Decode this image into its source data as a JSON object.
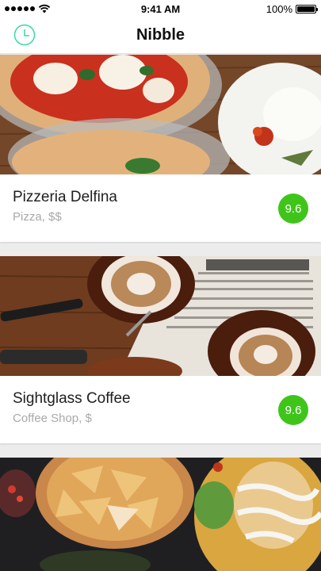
{
  "status_bar": {
    "time": "9:41 AM",
    "battery": "100%",
    "battery_level": 1.0,
    "signal_icon": "signal-dots-icon",
    "wifi_icon": "wifi-icon"
  },
  "nav": {
    "title": "Nibble",
    "history_icon": "clock-icon",
    "accent_color": "#3dd6a6"
  },
  "score_color": "#3fc51a",
  "places": [
    {
      "name": "Pizzeria Delfina",
      "category": "Pizza, $$",
      "score": "9.6",
      "photo": "pizza-photo"
    },
    {
      "name": "Sightglass Coffee",
      "category": "Coffee Shop, $",
      "score": "9.6",
      "photo": "coffee-photo"
    },
    {
      "photo": "nachos-photo"
    }
  ]
}
